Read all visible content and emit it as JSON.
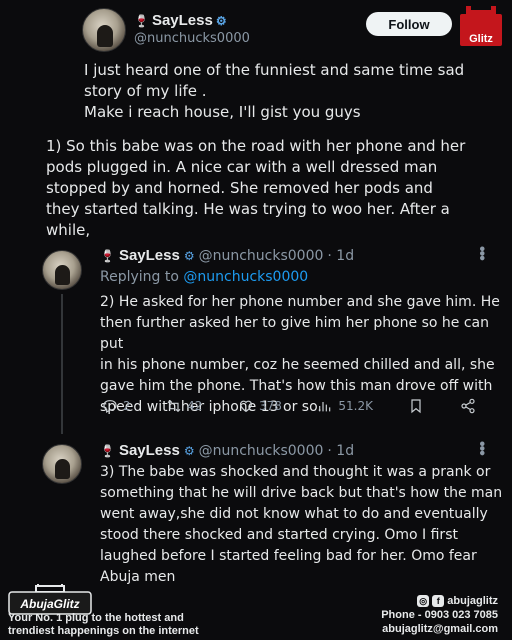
{
  "brand": {
    "badge_text": "Glitz",
    "footer_logo": "AbujaGlitz",
    "tagline_1": "Your No. 1 plug to the hottest and",
    "tagline_2": "trendiest happenings on the internet",
    "social_handle": "abujaglitz",
    "phone": "Phone - 0903 023 7085",
    "email": "abujaglitz@gmail.com",
    "accent": "#c4161c"
  },
  "main_tweet": {
    "name": "SayLess",
    "handle": "@nunchucks0000",
    "follow_label": "Follow",
    "text_1": "I just heard one of the funniest and same time sad",
    "text_2": "story of my life .",
    "text_3": "Make i reach house, I'll gist you guys",
    "para_1": "1) So this babe was on the road with her phone and her",
    "para_2": "pods plugged in. A nice car with a well dressed man",
    "para_3": "stopped by and horned. She removed her pods and",
    "para_4": "they started talking. He was trying to woo her. After a",
    "para_5": "while,"
  },
  "reply_1": {
    "name": "SayLess",
    "handle": "@nunchucks0000",
    "time": "· 1d",
    "replying_prefix": "Replying to ",
    "replying_handle": "@nunchucks0000",
    "lines": [
      "2) He asked for her phone number and she gave him. He",
      "then further asked her to give him her phone so he can put",
      "in his phone number, coz he seemed chilled and all, she",
      "gave him the phone. That's how this man drove off with",
      "speed with her iphone 13 or so."
    ],
    "replies": "2",
    "retweets": "42",
    "likes": "378",
    "views": "51.2K"
  },
  "reply_2": {
    "name": "SayLess",
    "handle": "@nunchucks0000",
    "time": "· 1d",
    "lines": [
      "3) The babe was shocked and thought it was a prank or",
      "something that he will drive back but that's how the man",
      "went away,she did not know what to do and eventually",
      "stood there shocked and started crying. Omo I first",
      "laughed before I started feeling bad for her. Omo fear",
      "Abuja men"
    ]
  },
  "icons": {
    "reply": "reply-icon",
    "retweet": "retweet-icon",
    "like": "heart-icon",
    "views": "views-icon",
    "bookmark": "bookmark-icon",
    "share": "share-icon",
    "more": "more-icon",
    "verified": "verified-icon"
  }
}
